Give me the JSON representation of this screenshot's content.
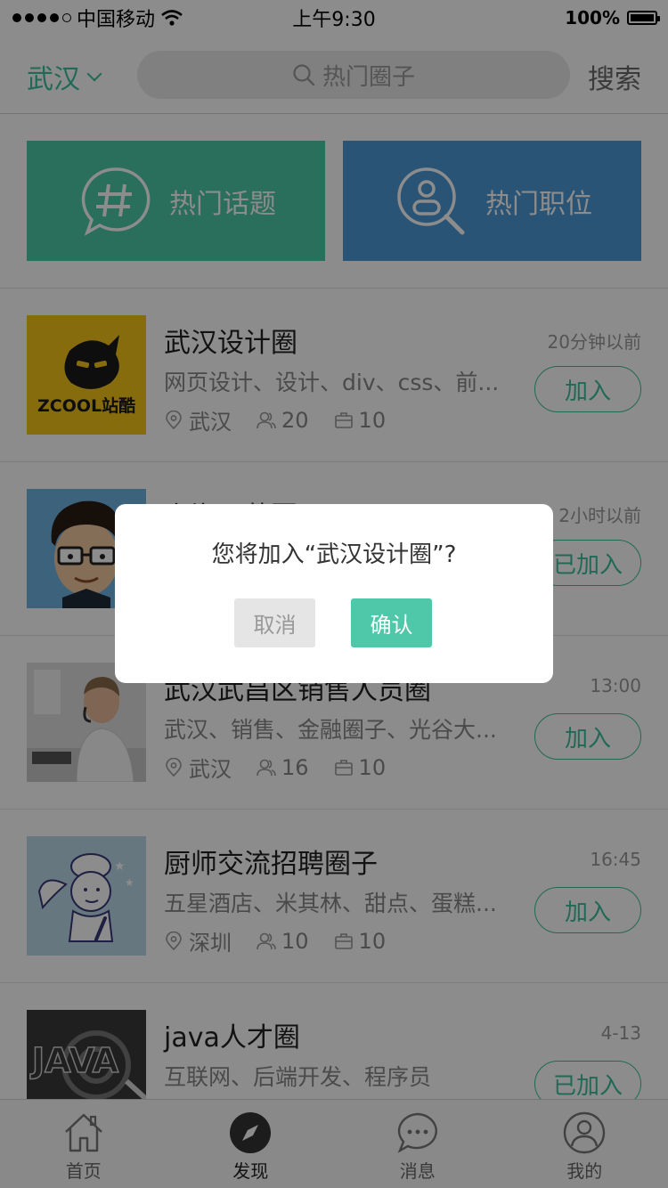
{
  "status_bar": {
    "carrier": "中国移动",
    "time": "上午9:30",
    "battery": "100%"
  },
  "header": {
    "city": "武汉",
    "search_placeholder": "热门圈子",
    "search_button": "搜索"
  },
  "tiles": [
    {
      "label": "热门话题",
      "icon": "hash-chat-icon",
      "color": "#4ec8a8"
    },
    {
      "label": "热门职位",
      "icon": "person-search-icon",
      "color": "#4d9ad5"
    }
  ],
  "circles": [
    {
      "title": "武汉设计圈",
      "time": "20分钟以前",
      "tags": "网页设计、设计、div、css、前...",
      "location": "武汉",
      "members": "20",
      "jobs": "10",
      "action": "加入"
    },
    {
      "title": "上海运营圈",
      "time": "2小时以前",
      "tags": "",
      "location": "",
      "members": "",
      "jobs": "",
      "action": "已加入"
    },
    {
      "title": "武汉武昌区销售人员圈",
      "time": "13:00",
      "tags": "武汉、销售、金融圈子、光谷大...",
      "location": "武汉",
      "members": "16",
      "jobs": "10",
      "action": "加入"
    },
    {
      "title": "厨师交流招聘圈子",
      "time": "16:45",
      "tags": "五星酒店、米其林、甜点、蛋糕...",
      "location": "深圳",
      "members": "10",
      "jobs": "10",
      "action": "加入"
    },
    {
      "title": "java人才圈",
      "time": "4-13",
      "tags": "互联网、后端开发、程序员",
      "location": "",
      "members": "",
      "jobs": "",
      "action": "已加入"
    }
  ],
  "tabbar": [
    {
      "label": "首页",
      "icon": "home-icon"
    },
    {
      "label": "发现",
      "icon": "compass-icon",
      "active": true
    },
    {
      "label": "消息",
      "icon": "chat-bubble-icon"
    },
    {
      "label": "我的",
      "icon": "user-icon"
    }
  ],
  "dialog": {
    "message": "您将加入“武汉设计圈”?",
    "cancel": "取消",
    "confirm": "确认"
  },
  "colors": {
    "accent": "#3bbf9c",
    "topics_tile": "#4ec8a8",
    "jobs_tile": "#4d9ad5",
    "overlay": "rgba(0,0,0,0.45)"
  }
}
